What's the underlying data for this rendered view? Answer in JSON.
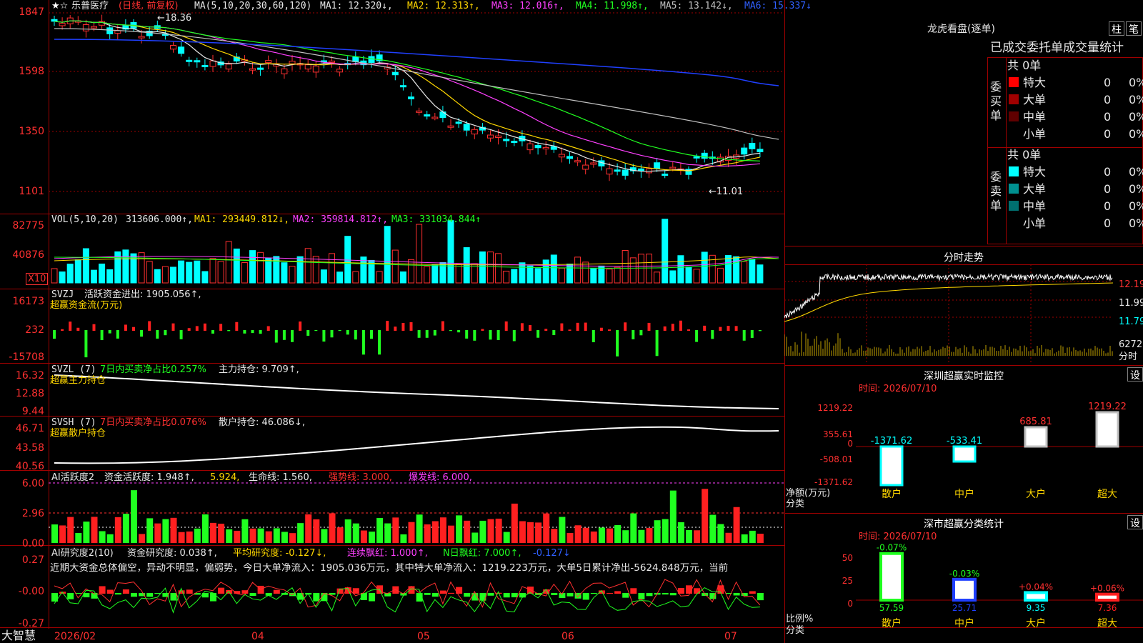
{
  "stock": {
    "name": "乐普医疗",
    "period": "(日线, 前复权)"
  },
  "ma_line": {
    "label": "MA(5,10,20,30,60,120)",
    "items": [
      {
        "text": "MA1: 12.320↓,",
        "color": "#e8e8e8"
      },
      {
        "text": "MA2: 12.313↑,",
        "color": "#ffd700"
      },
      {
        "text": "MA3: 12.016↑,",
        "color": "#ff40ff"
      },
      {
        "text": "MA4: 11.998↑,",
        "color": "#20ff20"
      },
      {
        "text": "MA5: 13.142↓,",
        "color": "#c0c0c0"
      },
      {
        "text": "MA6: 15.337↓",
        "color": "#3060ff"
      }
    ]
  },
  "main_axis": [
    "1847",
    "1598",
    "1350",
    "1101"
  ],
  "annotations": {
    "high": "←18.36",
    "low": "←11.01"
  },
  "vol": {
    "label": "VOL(5,10,20)",
    "value": "313606.000↑,",
    "ma1": "MA1: 293449.812↓,",
    "ma2": "MA2: 359814.812↑,",
    "ma3": "MA3: 331034.844↑",
    "axis": [
      "82775",
      "40876"
    ],
    "unit": "X10"
  },
  "svzj": {
    "label": "SVZJ",
    "desc": "活跃资金进出: 1905.056↑,",
    "sub": "超赢资金流(万元)",
    "axis": [
      "16173",
      "232",
      "-15708"
    ]
  },
  "svzl": {
    "label": "SVZL (7)",
    "desc": "7日内买卖净占比0.257%",
    "hold": "主力持仓: 9.709↑,",
    "sub": "超赢主力持仓",
    "axis": [
      "16.32",
      "12.88",
      "9.44"
    ]
  },
  "svsh": {
    "label": "SVSH (7)",
    "desc": "7日内买卖净占比0.076%",
    "hold": "散户持仓: 46.086↓,",
    "sub": "超赢散户持仓",
    "axis": [
      "46.71",
      "43.58",
      "40.56"
    ]
  },
  "ai2": {
    "label": "AI活跃度2",
    "a": "资金活跃度: 1.948↑,",
    "b": "5.924,",
    "c": "生命线: 1.560,",
    "d": "强势线: 3.000,",
    "e": "爆发线: 6.000,",
    "axis": [
      "6.00",
      "2.96",
      "0.00"
    ]
  },
  "ai_research": {
    "label": "AI研究度2(10)",
    "a": "资金研究度: 0.038↑,",
    "b": "平均研究度: -0.127↓,",
    "c": "连续飘红: 1.000↑,",
    "d": "N日飘红: 7.000↑,",
    "e": "-0.127↓",
    "axis": [
      "0.27",
      "-0.00",
      "-0.27"
    ],
    "text": "近期大资金总体偏空，异动不明显，偏弱势，今日大单净流入：1905.036万元，其中特大单净流入：1219.223万元，大单5日累计净出-5624.848万元，当前"
  },
  "date_axis": [
    "2026/02",
    "04",
    "05",
    "06",
    "07"
  ],
  "brand": "大智慧",
  "chart_data": {
    "type": "line",
    "title": "乐普医疗",
    "x": [
      "2026/02",
      "04",
      "05",
      "06",
      "07"
    ],
    "ylim": [
      11.01,
      18.47
    ],
    "series": [
      {
        "name": "MA1",
        "last": 12.32
      },
      {
        "name": "MA2",
        "last": 12.313
      },
      {
        "name": "MA3",
        "last": 12.016
      },
      {
        "name": "MA4",
        "last": 11.998
      },
      {
        "name": "MA5",
        "last": 13.142
      },
      {
        "name": "MA6",
        "last": 15.337
      }
    ]
  },
  "right": {
    "dragon_title": "龙虎看盘(逐单)",
    "btn_pillar": "柱",
    "btn_pen": "笔",
    "section_title": "已成交委托单成交量统计",
    "buy": {
      "vert": "委买单",
      "total": "共 0单",
      "rows": [
        {
          "name": "特大",
          "v": "0",
          "p": "0%",
          "color": "#ff0000"
        },
        {
          "name": "大单",
          "v": "0",
          "p": "0%",
          "color": "#a00000"
        },
        {
          "name": "中单",
          "v": "0",
          "p": "0%",
          "color": "#600000"
        },
        {
          "name": "小单",
          "v": "0",
          "p": "0%",
          "color": "#000000"
        }
      ]
    },
    "sell": {
      "vert": "委卖单",
      "total": "共 0单",
      "rows": [
        {
          "name": "特大",
          "v": "0",
          "p": "0%",
          "color": "#00ffff"
        },
        {
          "name": "大单",
          "v": "0",
          "p": "0%",
          "color": "#009090"
        },
        {
          "name": "中单",
          "v": "0",
          "p": "0%",
          "color": "#007070"
        },
        {
          "name": "小单",
          "v": "0",
          "p": "0%",
          "color": "#000000"
        }
      ]
    },
    "intraday": {
      "title": "分时走势",
      "axis": [
        "12.19",
        "11.99",
        "11.79"
      ],
      "vol": "6272",
      "unit": "分时"
    },
    "sz_monitor": {
      "title": "深圳超赢实时监控",
      "btn": "设",
      "time": "时间: 2026/07/10",
      "axis": [
        "1219.22",
        "355.61",
        "0",
        "-508.01",
        "-1371.62"
      ],
      "ylabel": "净额(万元)",
      "xlabel": "分类",
      "bars": [
        {
          "cat": "散户",
          "v": "-1371.62"
        },
        {
          "cat": "中户",
          "v": "-533.41"
        },
        {
          "cat": "大户",
          "v": "685.81"
        },
        {
          "cat": "超大",
          "v": "1219.22"
        }
      ]
    },
    "sz_class": {
      "title": "深市超赢分类统计",
      "btn": "设",
      "time": "时间: 2026/07/10",
      "axis": [
        "75",
        "50",
        "25",
        "0"
      ],
      "ylabel": "比例%",
      "xlabel": "分类",
      "bars": [
        {
          "cat": "散户",
          "pct": "57.59",
          "chg": "-0.07%"
        },
        {
          "cat": "中户",
          "pct": "25.71",
          "chg": "-0.03%"
        },
        {
          "cat": "大户",
          "pct": "9.35",
          "chg": "+0.04%"
        },
        {
          "cat": "超大",
          "pct": "7.36",
          "chg": "+0.06%"
        }
      ]
    }
  }
}
